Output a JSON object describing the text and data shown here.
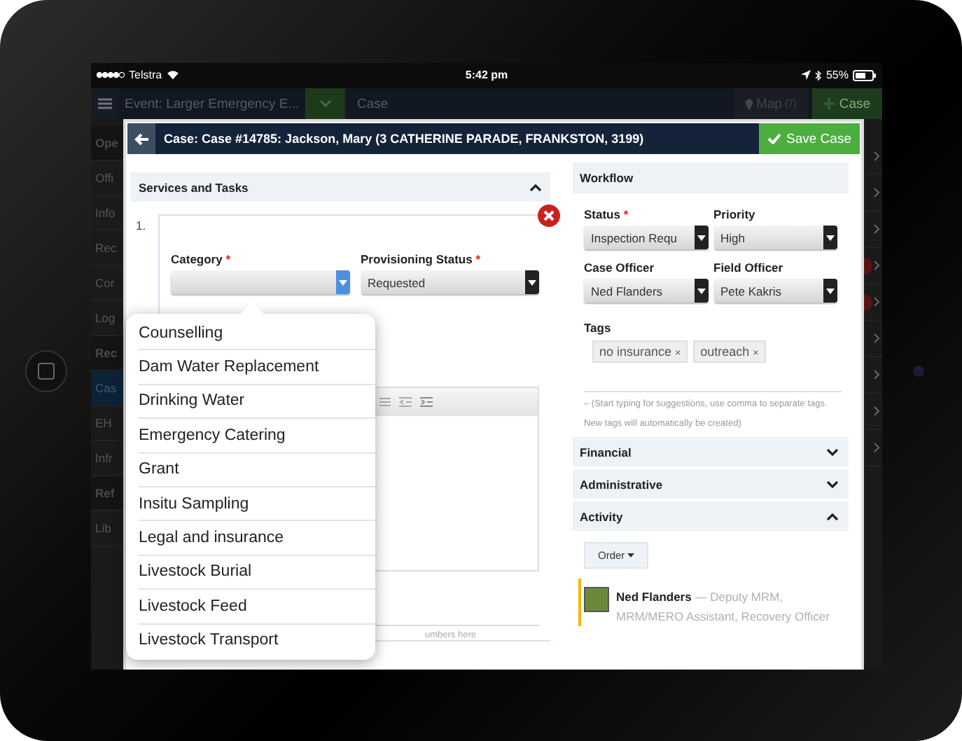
{
  "status_bar": {
    "carrier": "Telstra",
    "time": "5:42 pm",
    "battery": "55%"
  },
  "nav": {
    "event": "Event: Larger Emergency E...",
    "section": "Case",
    "map": "Map",
    "map_count": "(7)",
    "new_case": "Case"
  },
  "sidebar": [
    {
      "label": "Ope",
      "kind": "header",
      "selected": false
    },
    {
      "label": "Offi",
      "kind": "item",
      "selected": false
    },
    {
      "label": "Info",
      "kind": "item",
      "selected": false
    },
    {
      "label": "Rec",
      "kind": "item",
      "selected": false
    },
    {
      "label": "Cor",
      "kind": "item",
      "selected": false
    },
    {
      "label": "Log",
      "kind": "item",
      "selected": false
    },
    {
      "label": "Rec",
      "kind": "header",
      "selected": false
    },
    {
      "label": "Cas",
      "kind": "item",
      "selected": true
    },
    {
      "label": "EH",
      "kind": "item",
      "selected": false
    },
    {
      "label": "Infr",
      "kind": "item",
      "selected": false
    },
    {
      "label": "Ref",
      "kind": "header",
      "selected": false
    },
    {
      "label": "Lib",
      "kind": "item",
      "selected": false
    }
  ],
  "modal": {
    "title": "Case: Case #14785: Jackson, Mary (3 CATHERINE PARADE, FRANKSTON, 3199)",
    "save": "Save Case"
  },
  "services": {
    "title": "Services and Tasks",
    "expanded": true,
    "item_number": "1.",
    "hint": "umbers here",
    "fields": [
      {
        "label": "Category",
        "mark": "*",
        "open": true
      },
      {
        "label": "Provisioning Status",
        "mark": "*",
        "value": "Requested",
        "open": false
      }
    ]
  },
  "category_menu": [
    "Counselling",
    "Dam Water Replacement",
    "Drinking Water",
    "Emergency Catering",
    "Grant",
    "Insitu Sampling",
    "Legal and insurance",
    "Livestock Burial",
    "Livestock Feed",
    "Livestock Transport"
  ],
  "workflow": {
    "title": "Workflow",
    "fields": [
      {
        "label": "Status",
        "mark": "*",
        "value": "Inspection Requ",
        "open": false
      },
      {
        "label": "Priority",
        "value": "High",
        "open": false
      },
      {
        "label": "Case Officer",
        "value": "Ned Flanders",
        "open": false
      },
      {
        "label": "Field Officer",
        "value": "Pete Kakris",
        "open": false
      }
    ],
    "tags_label": "Tags",
    "tags": [
      {
        "label": "no insurance",
        "remove": "×"
      },
      {
        "label": "outreach",
        "remove": "×"
      }
    ],
    "tags_hint": "– (Start typing for suggestions, use comma to separate tags. New tags will automatically be created)"
  },
  "panels": [
    {
      "title": "Financial",
      "expanded": false
    },
    {
      "title": "Administrative",
      "expanded": false
    },
    {
      "title": "Activity",
      "expanded": true
    }
  ],
  "activity": {
    "order": "Order",
    "entries": [
      {
        "name": "Ned Flanders",
        "role": "— Deputy MRM, MRM/MERO Assistant, Recovery Officer"
      }
    ]
  }
}
